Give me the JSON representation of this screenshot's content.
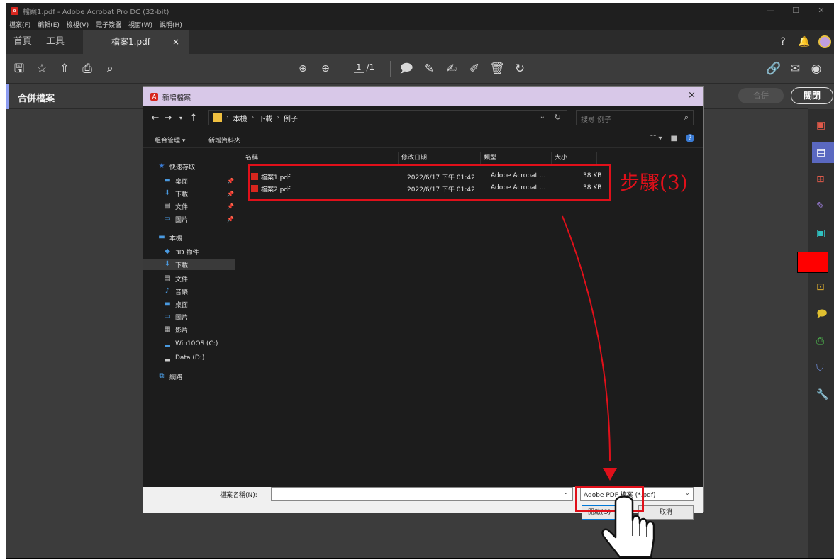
{
  "window": {
    "title": "檔案1.pdf - Adobe Acrobat Pro DC (32-bit)",
    "logo": "A",
    "controls": [
      "—",
      "☐",
      "✕"
    ]
  },
  "menubar": [
    "檔案(F)",
    "編輯(E)",
    "檢視(V)",
    "電子簽署",
    "視窗(W)",
    "說明(H)"
  ],
  "tabs": {
    "home": "首頁",
    "tools": "工具",
    "document": "檔案1.pdf",
    "close": "×"
  },
  "toolbar": {
    "page_current": "1",
    "page_total": "/1"
  },
  "combine": {
    "title": "合併檔案",
    "combine_button": "合併",
    "close_button": "關閉"
  },
  "dialog": {
    "title": "新增檔案",
    "close": "×",
    "breadcrumb": [
      "本機",
      "下載",
      "例子"
    ],
    "search_placeholder": "搜尋 例子",
    "organize": "組合管理 ▾",
    "new_folder": "新增資料夾",
    "columns": {
      "name": "名稱",
      "modified": "修改日期",
      "type": "類型",
      "size": "大小"
    },
    "nav": {
      "quick_access": "快速存取",
      "desktop": "桌面",
      "downloads": "下載",
      "documents": "文件",
      "pictures": "圖片",
      "this_pc": "本機",
      "objects3d": "3D 物件",
      "downloads2": "下載",
      "documents2": "文件",
      "music": "音樂",
      "desktop2": "桌面",
      "pictures2": "圖片",
      "videos": "影片",
      "drive_c": "Win10OS (C:)",
      "drive_d": "Data (D:)",
      "network": "網路"
    },
    "files": [
      {
        "name": "檔案1.pdf",
        "modified": "2022/6/17 下午 01:42",
        "type": "Adobe Acrobat ...",
        "size": "38 KB"
      },
      {
        "name": "檔案2.pdf",
        "modified": "2022/6/17 下午 01:42",
        "type": "Adobe Acrobat ...",
        "size": "38 KB"
      }
    ],
    "filename_label": "檔案名稱(N):",
    "filename_value": "",
    "filter": "Adobe PDF 檔案 (*.pdf)",
    "open_button": "開啟(O)",
    "cancel_button": "取消"
  },
  "annotation": {
    "step_label": "步驟(3)",
    "color": "#e0101a"
  },
  "colors": {
    "app_bg": "#3c3c3c",
    "titlebar": "#1f1f1f",
    "dialog_title_bg": "#d8c8e8",
    "accent": "#8c9cf0"
  }
}
